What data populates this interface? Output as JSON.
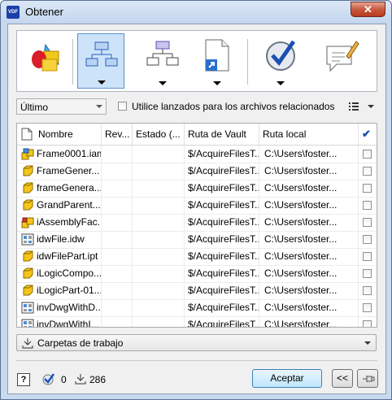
{
  "window": {
    "title": "Obtener",
    "app_icon_text": "VDF",
    "close_glyph": "✕"
  },
  "toolbar": {
    "buttons": [
      {
        "name": "application-options-icon",
        "has_dropdown": false
      },
      {
        "name": "structure-tree-icon",
        "has_dropdown": true,
        "selected": true
      },
      {
        "name": "flat-structure-icon",
        "has_dropdown": true
      },
      {
        "name": "document-shortcut-icon",
        "has_dropdown": true
      },
      {
        "name": "checkmark-circle-icon",
        "has_dropdown": true
      },
      {
        "name": "comment-pencil-icon",
        "has_dropdown": false
      }
    ]
  },
  "filter": {
    "version_selected": "Último",
    "use_released_label": "Utilice lanzados para los archivos relacionados",
    "use_released_checked": false,
    "list_menu_icon": "list-options-icon"
  },
  "grid": {
    "columns": [
      "Nombre",
      "Rev...",
      "Estado (...",
      "Ruta de Vault",
      "Ruta local",
      "✔"
    ],
    "rows": [
      {
        "name": "Frame0001.iam",
        "icon": "assembly",
        "rev": "",
        "state": "",
        "vault": "$/AcquireFilesT...",
        "local": "C:\\Users\\foster..."
      },
      {
        "name": "FrameGener...",
        "icon": "part",
        "rev": "",
        "state": "",
        "vault": "$/AcquireFilesT...",
        "local": "C:\\Users\\foster..."
      },
      {
        "name": "frameGenera...",
        "icon": "part",
        "rev": "",
        "state": "",
        "vault": "$/AcquireFilesT...",
        "local": "C:\\Users\\foster..."
      },
      {
        "name": "GrandParent...",
        "icon": "part",
        "rev": "",
        "state": "",
        "vault": "$/AcquireFilesT...",
        "local": "C:\\Users\\foster..."
      },
      {
        "name": "iAssemblyFac...",
        "icon": "assembly-factory",
        "rev": "",
        "state": "",
        "vault": "$/AcquireFilesT...",
        "local": "C:\\Users\\foster..."
      },
      {
        "name": "idwFile.idw",
        "icon": "drawing",
        "rev": "",
        "state": "",
        "vault": "$/AcquireFilesT...",
        "local": "C:\\Users\\foster..."
      },
      {
        "name": "idwFilePart.ipt",
        "icon": "part",
        "rev": "",
        "state": "",
        "vault": "$/AcquireFilesT...",
        "local": "C:\\Users\\foster..."
      },
      {
        "name": "iLogicCompo...",
        "icon": "part",
        "rev": "",
        "state": "",
        "vault": "$/AcquireFilesT...",
        "local": "C:\\Users\\foster..."
      },
      {
        "name": "iLogicPart-01...",
        "icon": "part",
        "rev": "",
        "state": "",
        "vault": "$/AcquireFilesT...",
        "local": "C:\\Users\\foster..."
      },
      {
        "name": "invDwgWithD...",
        "icon": "drawing",
        "rev": "",
        "state": "",
        "vault": "$/AcquireFilesT...",
        "local": "C:\\Users\\foster..."
      },
      {
        "name": "invDwgWithI...",
        "icon": "drawing",
        "rev": "",
        "state": "",
        "vault": "$/AcquireFilesT...",
        "local": "C:\\Users\\foster..."
      }
    ]
  },
  "workspace": {
    "label": "Carpetas de trabajo",
    "icon": "download-icon"
  },
  "footer": {
    "help_glyph": "?",
    "checked_count": "0",
    "download_count": "286",
    "accept_label": "Aceptar",
    "collapse_label": "<<",
    "pin_icon": "pin-icon"
  },
  "colors": {
    "accent": "#1b3fa8",
    "selected_bg": "#cde3f9",
    "check_blue": "#1a4fb5"
  }
}
